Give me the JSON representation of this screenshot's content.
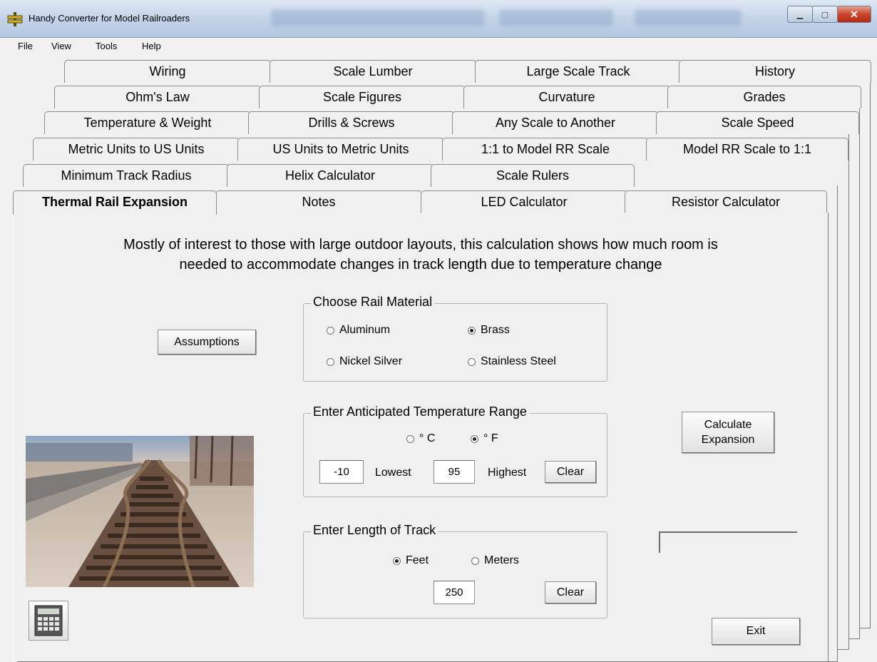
{
  "window": {
    "title": "Handy Converter for Model Railroaders"
  },
  "menu": {
    "items": [
      "File",
      "View",
      "Tools",
      "Help"
    ]
  },
  "tabs": {
    "row1": [
      "Wiring",
      "Scale Lumber",
      "Large Scale Track",
      "History"
    ],
    "row2": [
      "Ohm's Law",
      "Scale Figures",
      "Curvature",
      "Grades"
    ],
    "row3": [
      "Temperature & Weight",
      "Drills & Screws",
      "Any Scale to Another",
      "Scale Speed"
    ],
    "row4": [
      "Metric Units to US Units",
      "US Units to Metric Units",
      "1:1 to Model RR Scale",
      "Model RR Scale to 1:1"
    ],
    "row5": [
      "Minimum Track Radius",
      "Helix Calculator",
      "Scale Rulers"
    ],
    "row6": [
      "Thermal Rail Expansion",
      "Notes",
      "LED Calculator",
      "Resistor Calculator"
    ],
    "active": "Thermal Rail Expansion"
  },
  "description": {
    "line1": "Mostly of interest to those with large outdoor layouts, this calculation shows how much room is",
    "line2": "needed to accommodate changes in track length due to temperature change"
  },
  "buttons": {
    "assumptions": "Assumptions",
    "calculate_line1": "Calculate",
    "calculate_line2": "Expansion",
    "clear_temp": "Clear",
    "clear_length": "Clear",
    "exit": "Exit"
  },
  "rail_material": {
    "legend": "Choose Rail Material",
    "options": [
      "Aluminum",
      "Brass",
      "Nickel Silver",
      "Stainless Steel"
    ],
    "selected": "Brass"
  },
  "temperature": {
    "legend": "Enter Anticipated Temperature Range",
    "unit_c": "° C",
    "unit_f": "° F",
    "selected_unit": "° F",
    "lowest_value": "-10",
    "lowest_label": "Lowest",
    "highest_value": "95",
    "highest_label": "Highest"
  },
  "track_length": {
    "legend": "Enter Length of Track",
    "unit_feet": "Feet",
    "unit_meters": "Meters",
    "selected_unit": "Feet",
    "value": "250"
  },
  "result": {
    "value": ""
  },
  "colors": {
    "title_bar": "#c6d6e9",
    "close_button": "#c8452c",
    "panel": "#f0f0f0"
  }
}
